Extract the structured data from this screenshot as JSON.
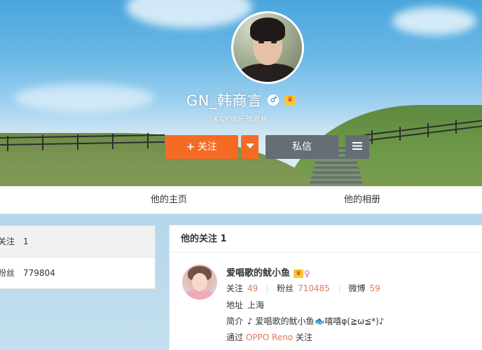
{
  "profile": {
    "name": "GN_韩商言",
    "subtitle": "K&K俱乐部老板",
    "gender_icon": "male-icon",
    "vip_icon": "vip-crown-icon"
  },
  "actions": {
    "follow_plus": "+",
    "follow_label": "关注",
    "message_label": "私信"
  },
  "tabs": [
    {
      "label": "他的主页"
    },
    {
      "label": "他的相册"
    }
  ],
  "left_stats": [
    {
      "label": "关注",
      "value": "1"
    },
    {
      "label": "粉丝",
      "value": "779804"
    }
  ],
  "following_card": {
    "title": "他的关注 1",
    "user": {
      "name": "爱唱歌的鱿小鱼",
      "stats": [
        {
          "label": "关注",
          "value": "49"
        },
        {
          "label": "粉丝",
          "value": "710485"
        },
        {
          "label": "微博",
          "value": "59"
        }
      ],
      "address_label": "地址",
      "address": "上海",
      "intro_label": "简介",
      "intro": "♪ 爱唱歌的鱿小鱼🐟嘻嘻φ(≧ω≦*)♪",
      "via_prefix": "通过",
      "via_source": "OPPO Reno",
      "via_suffix": "关注"
    }
  }
}
